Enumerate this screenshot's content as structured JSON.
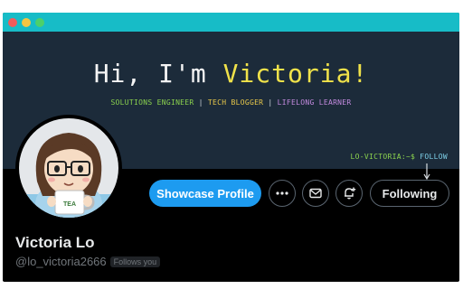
{
  "banner": {
    "greeting": "Hi, I'm ",
    "greeting_name": "Victoria!",
    "role1": "SOLUTIONS ENGINEER",
    "role2": "TECH BLOGGER",
    "role3": "LIFELONG LEARNER",
    "separator": " | ",
    "prompt": "LO-VICTORIA:~$ ",
    "prompt_command": "FOLLOW"
  },
  "avatar": {
    "mug_label": "TEA"
  },
  "actions": {
    "showcase_label": "Showcase Profile",
    "following_label": "Following"
  },
  "profile": {
    "display_name": "Victoria Lo",
    "handle": "@lo_victoria2666",
    "follows_you": "Follows you"
  },
  "colors": {
    "titlebar": "#17bcc7",
    "banner_bg": "#1c2b3a",
    "accent_blue": "#1d9bf0",
    "name_yellow": "#f0e24a"
  }
}
